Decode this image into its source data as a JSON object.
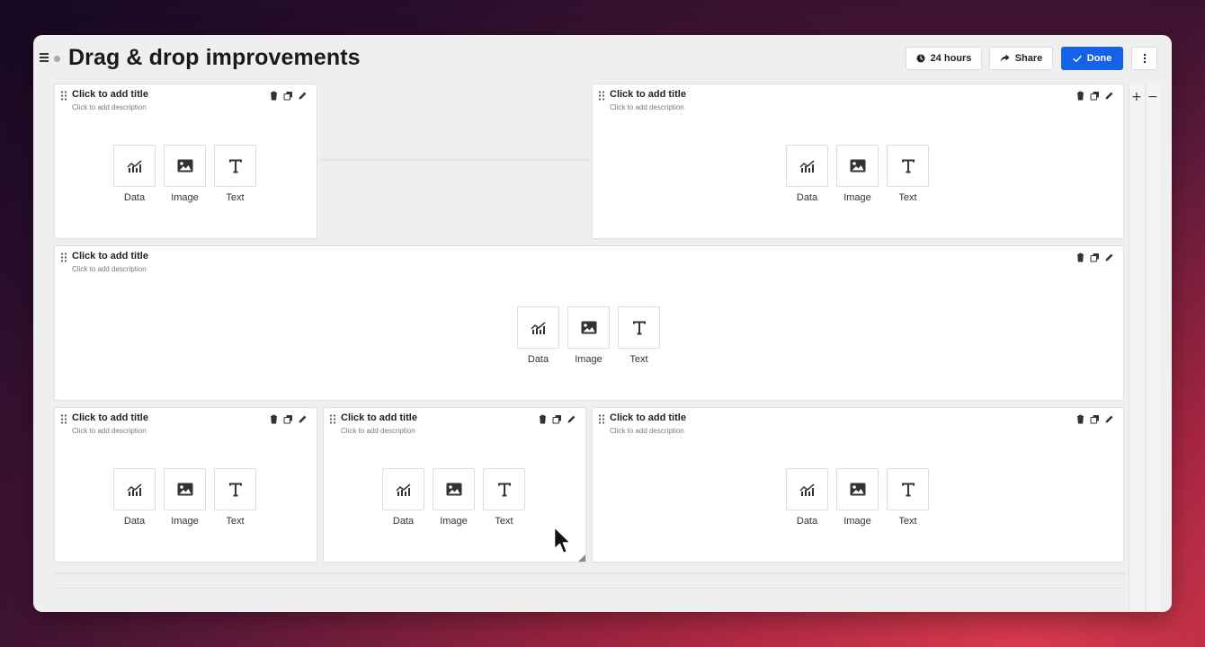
{
  "header": {
    "title": "Drag & drop improvements",
    "time_label": "24 hours",
    "share_label": "Share",
    "done_label": "Done"
  },
  "panels": [
    {
      "title": "Click to add title",
      "description": "Click to add description"
    },
    {
      "title": "Click to add title",
      "description": "Click to add description"
    },
    {
      "title": "Click to add title",
      "description": "Click to add description"
    },
    {
      "title": "Click to add title",
      "description": "Click to add description"
    },
    {
      "title": "Click to add title",
      "description": "Click to add description"
    },
    {
      "title": "Click to add title",
      "description": "Click to add description"
    }
  ],
  "choices": {
    "data": "Data",
    "image": "Image",
    "text": "Text"
  },
  "zoom": {
    "plus": "+",
    "minus": "−"
  },
  "colors": {
    "accent": "#1463e6"
  }
}
